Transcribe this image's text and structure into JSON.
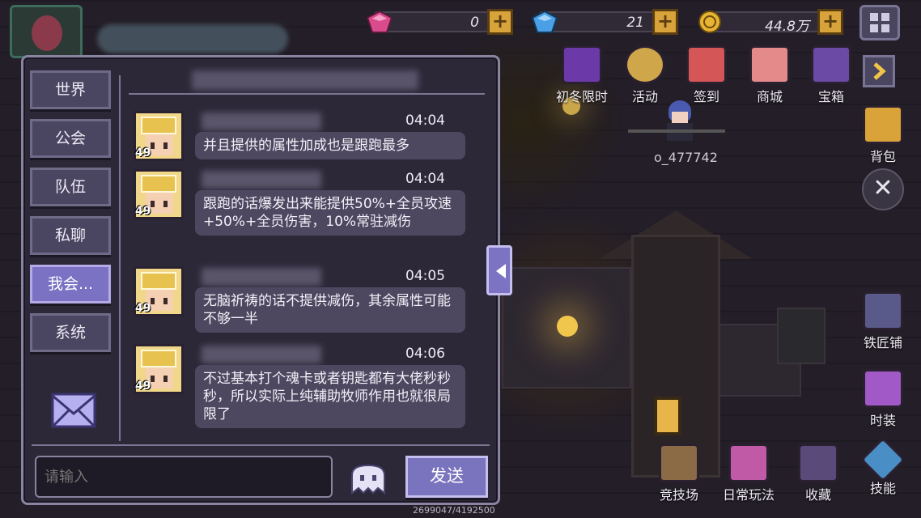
{
  "resources": [
    {
      "name": "gem-pink",
      "value": "0",
      "color": "#d94b8c"
    },
    {
      "name": "gem-blue",
      "value": "21",
      "color": "#4a9fe6"
    },
    {
      "name": "coin",
      "value": "44.8万",
      "color": "#e7b532"
    }
  ],
  "top_menu": [
    {
      "label": "初冬限时",
      "icon": "winter-event-icon",
      "color": "#6c3aa8"
    },
    {
      "label": "活动",
      "icon": "activity-icon",
      "color": "#cfa64a"
    },
    {
      "label": "签到",
      "icon": "sign-in-icon",
      "color": "#d45656"
    },
    {
      "label": "商城",
      "icon": "shop-icon",
      "color": "#e58a8a"
    },
    {
      "label": "宝箱",
      "icon": "treasure-chest-icon",
      "color": "#6b4aa6"
    }
  ],
  "side_menu": [
    {
      "label": "背包",
      "icon": "backpack-icon",
      "color": "#d9a33a"
    },
    {
      "label": "铁匠铺",
      "icon": "blacksmith-icon",
      "color": "#5a5a8a"
    },
    {
      "label": "时装",
      "icon": "fashion-icon",
      "color": "#a059c6"
    }
  ],
  "bottom_menu": [
    {
      "label": "竞技场",
      "icon": "arena-icon",
      "color": "#8b6a46"
    },
    {
      "label": "日常玩法",
      "icon": "daily-play-icon",
      "color": "#c05aa6"
    },
    {
      "label": "收藏",
      "icon": "collection-icon",
      "color": "#5a4a7a"
    },
    {
      "label": "技能",
      "icon": "skill-icon",
      "color": "#4a8ec6"
    }
  ],
  "player_name": "o_477742",
  "hp_text": "2699047/4192500",
  "chat": {
    "tabs": [
      {
        "label": "世界",
        "active": false
      },
      {
        "label": "公会",
        "active": false
      },
      {
        "label": "队伍",
        "active": false
      },
      {
        "label": "私聊",
        "active": false
      },
      {
        "label": "我会...",
        "active": true
      },
      {
        "label": "系统",
        "active": false
      }
    ],
    "messages": [
      {
        "level": "49",
        "time": "04:04",
        "text": "并且提供的属性加成也是跟跑最多"
      },
      {
        "level": "49",
        "time": "04:04",
        "text": "跟跑的话爆发出来能提供50%+全员攻速+50%+全员伤害，10%常驻减伤"
      },
      {
        "level": "49",
        "time": "04:05",
        "text": "无脑祈祷的话不提供减伤，其余属性可能不够一半"
      },
      {
        "level": "49",
        "time": "04:06",
        "text": "不过基本打个魂卡或者钥匙都有大佬秒秒秒，所以实际上纯辅助牧师作用也就很局限了"
      }
    ],
    "input_placeholder": "请输入",
    "send_label": "发送"
  }
}
